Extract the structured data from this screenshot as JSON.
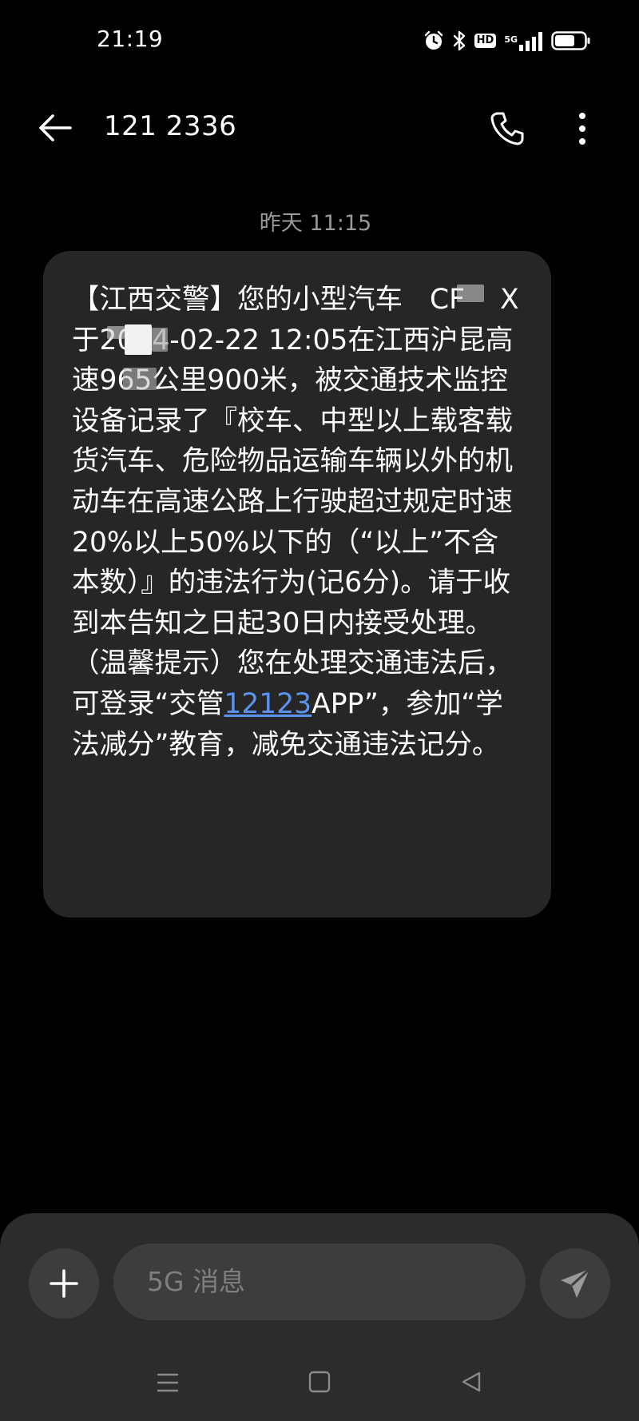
{
  "status_bar": {
    "time": "21:19",
    "icons": [
      "alarm-icon",
      "bluetooth-icon",
      "hd-icon",
      "5g-signal-icon",
      "battery-icon"
    ],
    "hd_label": "HD",
    "network_label": "5G"
  },
  "header": {
    "title": "121 2336",
    "back_icon": "arrow-left-icon",
    "call_icon": "phone-icon",
    "more_icon": "more-vertical-icon"
  },
  "conversation": {
    "timestamp": "昨天 11:15",
    "message": {
      "part1": "【江西交警】您的小型汽车",
      "part2": "CF",
      "part3": "X于2024-02-22 12:05在江西",
      "part4": "沪昆高速965公里900米，被交通技术监控设备记录了『校车、中型以上载客载货汽车、危险物品运输车辆以外的机动车在高速公路上行驶超过规定时速20%以上50%以下的（“以上”不含本数）』的违法行为(记6分)。请于收到本告知之日起30日内接受处理。（温馨提示）您在处理交通违法后，可登录“交管",
      "link": "12123",
      "part5": "APP”，参加“学法减分”教育，减免交通违法记分。"
    }
  },
  "composer": {
    "placeholder": "5G 消息",
    "attach_icon": "plus-icon",
    "send_icon": "send-icon"
  },
  "nav_bar": {
    "icons": [
      "menu-icon",
      "home-square-icon",
      "back-triangle-icon"
    ]
  },
  "colors": {
    "background": "#000000",
    "bubble": "#262626",
    "composer": "#2c2c2c",
    "button": "#3d3d3d",
    "link": "#5a94f0",
    "timestamp": "#9a9a9a"
  }
}
